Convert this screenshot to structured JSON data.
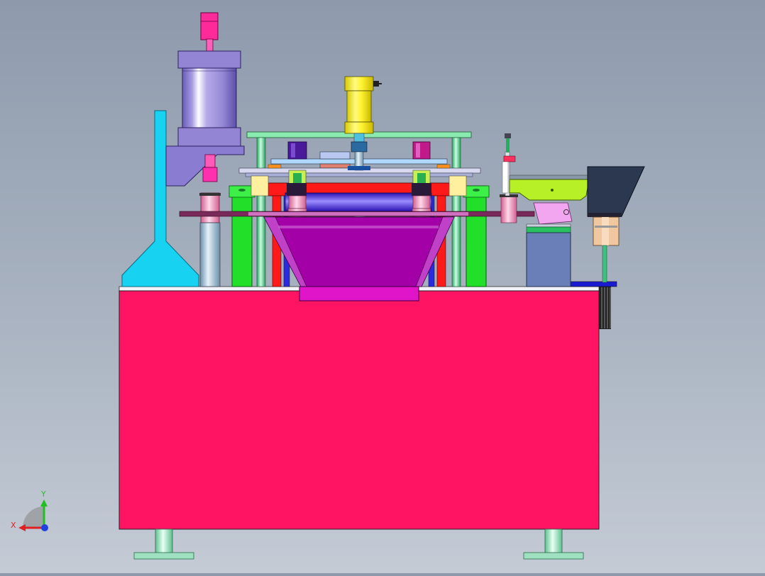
{
  "viewport": {
    "type": "cad-3d-view",
    "view": "front",
    "background": [
      "#8e9aac",
      "#c4cbd5"
    ]
  },
  "triad": {
    "x_label": "X",
    "y_label": "Y",
    "x_color": "#e02020",
    "y_color": "#20c020",
    "z_color": "#2040e0"
  },
  "colors": {
    "base": "#ff1464",
    "hopper": "#a400a8",
    "funnel": "#18d2f2",
    "cylinder_body": "#a79be0",
    "yellow_cylinder": "#fff230",
    "frame_green": "#22e02a",
    "frame_red": "#ff1a1a",
    "plate_blue": "#3c10d8",
    "feeder_lime": "#b8f028",
    "feeder_dark": "#2c3850",
    "motor_box": "#6a7eb8",
    "magenta_fitting": "#ff30b0"
  }
}
